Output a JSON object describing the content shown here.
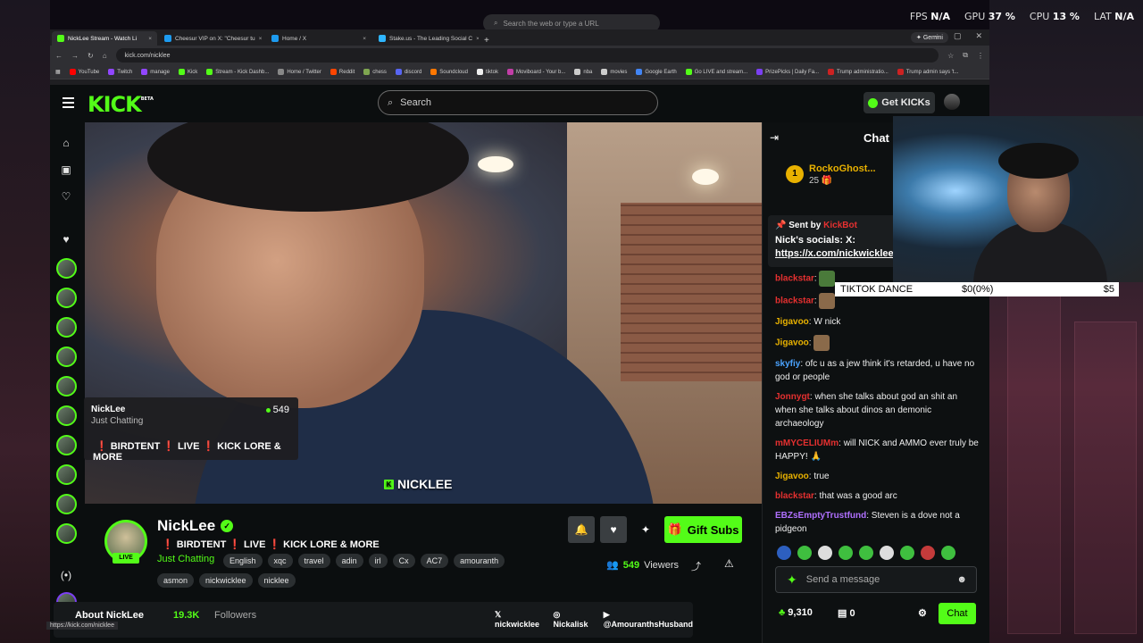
{
  "hud": {
    "fps_label": "FPS",
    "fps": "N/A",
    "gpu_label": "GPU",
    "gpu": "37 %",
    "cpu_label": "CPU",
    "cpu": "13 %",
    "lat_label": "LAT",
    "lat": "N/A"
  },
  "omnibar": {
    "placeholder": "Search the web or type a URL"
  },
  "browser": {
    "tabs": [
      {
        "label": "NickLee Stream - Watch Li",
        "color": "#53fc18"
      },
      {
        "label": "Cheesur VIP on X: \"Cheesur tu",
        "color": "#1d9bf0"
      },
      {
        "label": "Home / X",
        "color": "#1d9bf0"
      },
      {
        "label": "Stake.us - The Leading Social C",
        "color": "#2fb6ff"
      }
    ],
    "new_tab": "+",
    "gemini": "Gemini",
    "url": "kick.com/nicklee",
    "bookmarks": [
      {
        "label": "YouTube",
        "color": "#ff0000"
      },
      {
        "label": "Twitch",
        "color": "#9146ff"
      },
      {
        "label": "manage",
        "color": "#9146ff"
      },
      {
        "label": "Kick",
        "color": "#53fc18"
      },
      {
        "label": "Stream - Kick Dashb...",
        "color": "#53fc18"
      },
      {
        "label": "Home / Twitter",
        "color": "#888888"
      },
      {
        "label": "Reddit",
        "color": "#ff4500"
      },
      {
        "label": "chess",
        "color": "#7fa650"
      },
      {
        "label": "discord",
        "color": "#5865f2"
      },
      {
        "label": "Soundcloud",
        "color": "#ff7700"
      },
      {
        "label": "tiktok",
        "color": "#eeeeee"
      },
      {
        "label": "Moviboard - Your b...",
        "color": "#c23ea7"
      },
      {
        "label": "nba",
        "color": "#cccccc"
      },
      {
        "label": "movies",
        "color": "#cccccc"
      },
      {
        "label": "Google Earth",
        "color": "#4285f4"
      },
      {
        "label": "Go LIVE and stream...",
        "color": "#53fc18"
      },
      {
        "label": "PrizePicks | Daily Fa...",
        "color": "#7b3ff2"
      },
      {
        "label": "Trump administratio...",
        "color": "#cc2222"
      },
      {
        "label": "Trump admin says 't...",
        "color": "#cc2222"
      }
    ]
  },
  "kick": {
    "logo": "KICK",
    "logo_beta": "BETA",
    "search_placeholder": "Search",
    "get_kicks": "Get KICKs",
    "tooltip": {
      "name": "NickLee",
      "category": "Just Chatting",
      "viewers": "549",
      "title_parts": [
        "BIRDTENT",
        "LIVE",
        "KICK LORE & MORE"
      ]
    },
    "watermark": "NICKLEE",
    "channel": {
      "name": "NickLee",
      "live": "LIVE",
      "title_parts": [
        "BIRDTENT",
        "LIVE",
        "KICK LORE & MORE"
      ],
      "bang": "❗",
      "category": "Just Chatting",
      "tags_row1": [
        "English",
        "xqc",
        "travel",
        "adin",
        "irl",
        "Cx",
        "AC7",
        "amouranth"
      ],
      "tags_row2": [
        "asmon",
        "nickwicklee",
        "nicklee"
      ],
      "viewers": "549",
      "viewers_label": "Viewers",
      "gift_subs": "Gift Subs"
    },
    "about": {
      "label": "About NickLee",
      "followers_count": "19.3K",
      "followers_label": "Followers",
      "socials": [
        "nickwicklee",
        "Nickalisk",
        "@AmouranthsHusband"
      ]
    },
    "status_url": "https://kick.com/nicklee"
  },
  "chat": {
    "title": "Chat",
    "leader": {
      "rank": "1",
      "name": "RockoGhost...",
      "count": "25"
    },
    "pinned": {
      "sent_by": "Sent by",
      "bot": "KickBot",
      "message": "Nick's socials: X:",
      "link": "https://x.com/nickwicklee"
    },
    "messages": [
      {
        "user": "blackstar",
        "color": "#e53030",
        "text": "",
        "emote": true
      },
      {
        "user": "blackstar",
        "color": "#e53030",
        "text": "",
        "emote": true
      },
      {
        "user": "Jigavoo",
        "color": "#e8b100",
        "text": "W nick",
        "emote": false
      },
      {
        "user": "Jigavoo",
        "color": "#e8b100",
        "text": "",
        "emote": true
      },
      {
        "user": "skyfiy",
        "color": "#4aa3ff",
        "text": "ofc u as a jew think it's retarded, u have no god or people",
        "emote": false
      },
      {
        "user": "Jonnygt",
        "color": "#e53030",
        "text": "when she talks about god an shit an when she talks about dinos an demonic archaeology",
        "emote": false
      },
      {
        "user": "mMYCELIUMm",
        "color": "#e53030",
        "text": "will NICK and AMMO ever truly be HAPPY!",
        "emote": true
      },
      {
        "user": "Jigavoo",
        "color": "#e8b100",
        "text": "true",
        "emote": false
      },
      {
        "user": "blackstar",
        "color": "#e53030",
        "text": "that was a good arc",
        "emote": false
      },
      {
        "user": "EBZsEmptyTrustfund",
        "color": "#b070ff",
        "text": "Steven is a dove not a pidgeon",
        "emote": false
      }
    ],
    "send_placeholder": "Send a message",
    "kicks_balance": "9,310",
    "points": "0",
    "chat_button": "Chat"
  },
  "overlay": {
    "goal_label": "TIKTOK DANCE",
    "goal_progress": "$0(0%)",
    "goal_target": "$5"
  }
}
